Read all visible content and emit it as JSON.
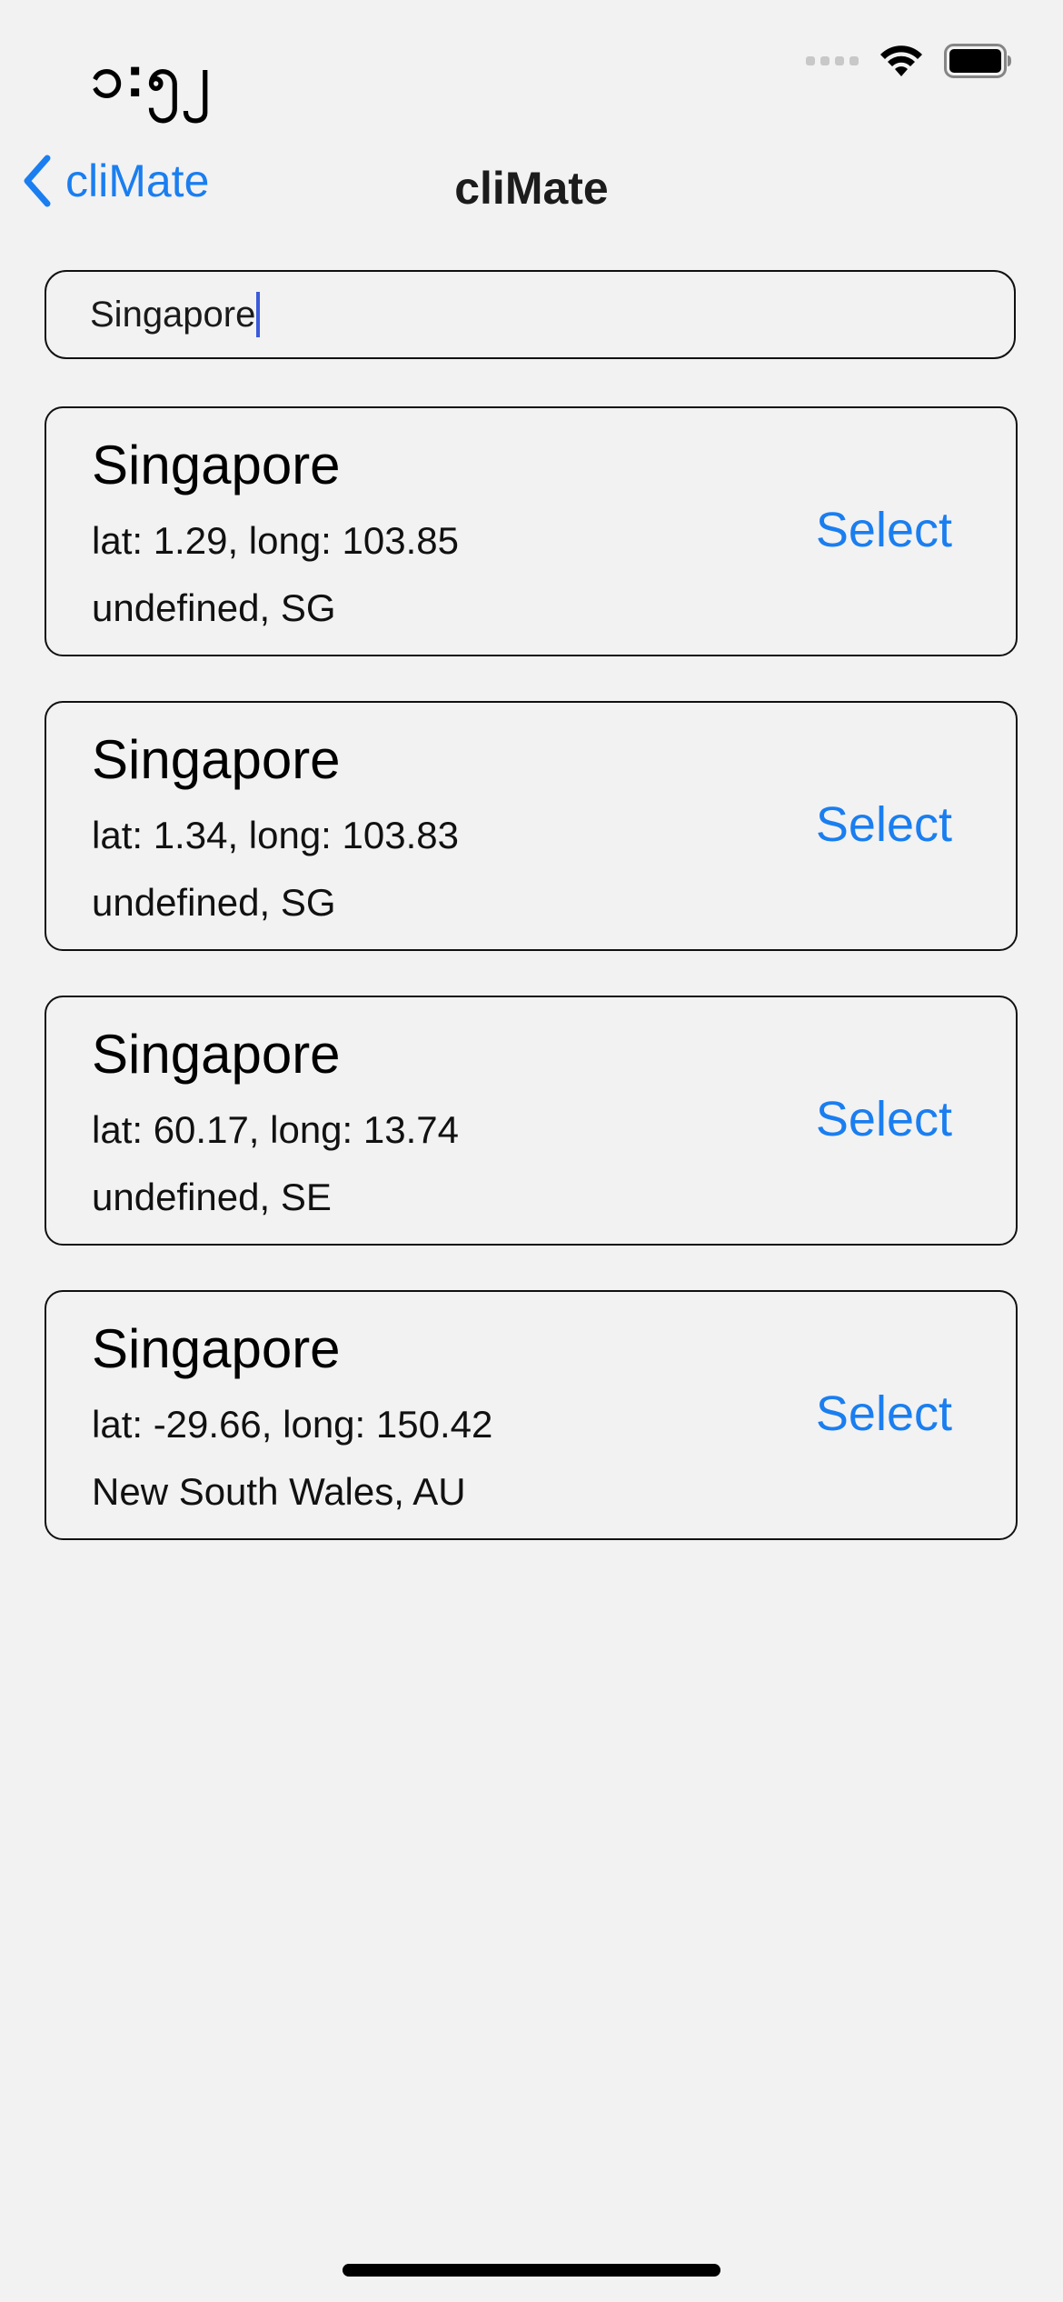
{
  "status_bar": {
    "time": "၁:၅၂"
  },
  "nav": {
    "back_label": "cliMate",
    "title": "cliMate"
  },
  "search": {
    "value": "Singapore"
  },
  "results": [
    {
      "name": "Singapore",
      "coords": "lat: 1.29, long: 103.85",
      "region": "undefined, SG",
      "select_label": "Select"
    },
    {
      "name": "Singapore",
      "coords": "lat: 1.34, long: 103.83",
      "region": "undefined, SG",
      "select_label": "Select"
    },
    {
      "name": "Singapore",
      "coords": "lat: 60.17, long: 13.74",
      "region": "undefined, SE",
      "select_label": "Select"
    },
    {
      "name": "Singapore",
      "coords": "lat: -29.66, long: 150.42",
      "region": "New South Wales, AU",
      "select_label": "Select"
    }
  ],
  "colors": {
    "accent": "#1a7ef0",
    "background": "#f2f2f2",
    "caret": "#3b5bdb"
  },
  "icons": {
    "signal": "cellular-signal-icon",
    "wifi": "wifi-icon",
    "battery": "battery-icon",
    "back": "chevron-left-icon"
  }
}
